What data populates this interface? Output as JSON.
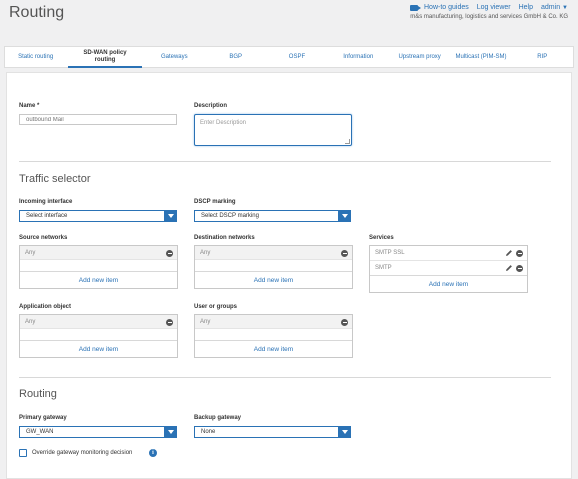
{
  "page": {
    "title": "Routing"
  },
  "top_links": {
    "howto": "How-to guides",
    "log_viewer": "Log viewer",
    "help": "Help",
    "admin": "admin",
    "company": "m&s manufacturing, logistics and services GmbH & Co. KG"
  },
  "tabs": [
    {
      "label": "Static routing",
      "active": false
    },
    {
      "label": "SD-WAN policy routing",
      "active": true
    },
    {
      "label": "Gateways",
      "active": false
    },
    {
      "label": "BGP",
      "active": false
    },
    {
      "label": "OSPF",
      "active": false
    },
    {
      "label": "Information",
      "active": false
    },
    {
      "label": "Upstream proxy",
      "active": false
    },
    {
      "label": "Multicast (PIM-SM)",
      "active": false
    },
    {
      "label": "RIP",
      "active": false
    }
  ],
  "form": {
    "name_label": "Name *",
    "name_placeholder": "outbound Mail",
    "description_label": "Description",
    "description_placeholder": "Enter Description",
    "traffic_selector_title": "Traffic selector",
    "incoming_label": "Incoming interface",
    "incoming_value": "Select interface",
    "dscp_label": "DSCP marking",
    "dscp_value": "Select DSCP marking",
    "source_label": "Source networks",
    "source_items": [
      "Any"
    ],
    "destination_label": "Destination networks",
    "destination_items": [
      "Any"
    ],
    "services_label": "Services",
    "services_items": [
      "SMTP SSL",
      "SMTP"
    ],
    "application_label": "Application object",
    "application_items": [
      "Any"
    ],
    "user_label": "User or groups",
    "user_items": [
      "Any"
    ],
    "add_new_item": "Add new item",
    "routing_title": "Routing",
    "primary_label": "Primary gateway",
    "primary_value": "GW_WAN",
    "backup_label": "Backup gateway",
    "backup_value": "None",
    "override_label": "Override gateway monitoring decision",
    "override_checked": false
  },
  "colors": {
    "accent": "#2a72b5",
    "background": "#f0f0f1"
  }
}
